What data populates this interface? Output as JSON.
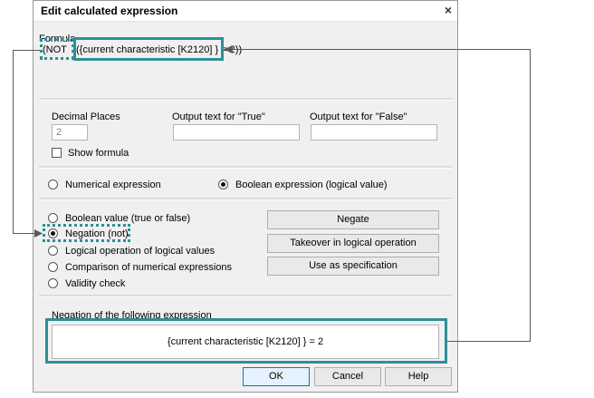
{
  "dialog": {
    "title": "Edit calculated expression",
    "close_glyph": "×",
    "formula_label": "Formula",
    "formula_not": "(NOT",
    "formula_expr": "({current characteristic [K2120] } = 2))",
    "decimal_label": "Decimal Places",
    "decimal_value": "2",
    "true_label": "Output text for \"True\"",
    "false_label": "Output text for \"False\"",
    "show_formula_label": "Show formula",
    "expr_types": [
      {
        "label": "Numerical expression",
        "selected": false
      },
      {
        "label": "Boolean expression (logical value)",
        "selected": true
      }
    ],
    "options": [
      {
        "label": "Boolean value (true or false)",
        "selected": false
      },
      {
        "label": "Negation (not)",
        "selected": true
      },
      {
        "label": "Logical operation of logical values",
        "selected": false
      },
      {
        "label": "Comparison of numerical expressions",
        "selected": false
      },
      {
        "label": "Validity check",
        "selected": false
      }
    ],
    "buttons": {
      "negate": "Negate",
      "takeover": "Takeover in logical operation",
      "use_spec": "Use as specification"
    },
    "negation_label": "Negation of the following expression",
    "negation_expr": "{current characteristic [K2120] } = 2",
    "footer": {
      "ok": "OK",
      "cancel": "Cancel",
      "help": "Help"
    }
  },
  "colors": {
    "highlight": "#2e8f99",
    "connector": "#5a5a5a",
    "dialog_bg": "#f0f0f0"
  }
}
